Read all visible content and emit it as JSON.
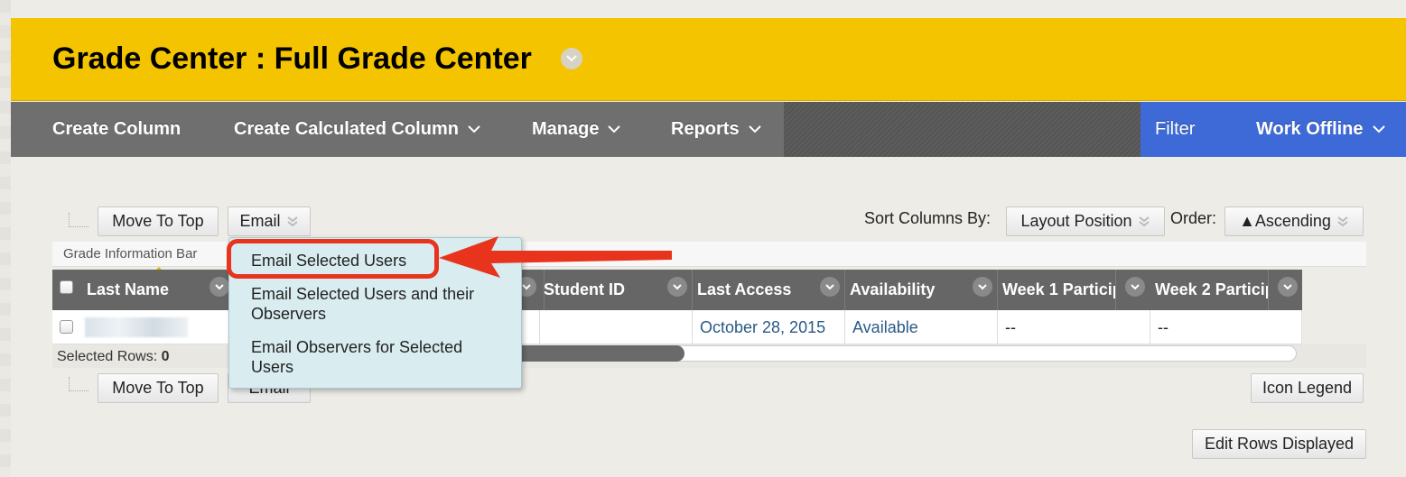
{
  "header": {
    "title": "Grade Center : Full Grade Center"
  },
  "nav": {
    "create_column": "Create Column",
    "create_calculated_column": "Create Calculated Column",
    "manage": "Manage",
    "reports": "Reports",
    "filter": "Filter",
    "work_offline": "Work Offline"
  },
  "toolbar": {
    "move_to_top": "Move To Top",
    "email": "Email",
    "sort_columns_by_label": "Sort Columns By:",
    "sort_columns_by_value": "Layout Position",
    "order_label": "Order:",
    "order_value": "▲Ascending"
  },
  "info_bar": {
    "label": "Grade Information Bar"
  },
  "grid": {
    "columns": [
      "Last Name",
      "Student ID",
      "Last Access",
      "Availability",
      "Week 1 Particip",
      "Week 2 Particip"
    ],
    "row": {
      "student_id": "",
      "last_access": "October 28, 2015",
      "availability": "Available",
      "week1": "--",
      "week2": "--"
    },
    "selected_rows_label": "Selected Rows:",
    "selected_rows_count": "0"
  },
  "email_menu": {
    "items": [
      "Email Selected Users",
      "Email Selected Users and their",
      "Observers",
      "Email Observers for Selected",
      "Users"
    ]
  },
  "bottom_toolbar": {
    "move_to_top": "Move To Top",
    "email": "Email",
    "icon_legend": "Icon Legend",
    "edit_rows_displayed": "Edit Rows Displayed"
  },
  "colors": {
    "header_bg": "#f5c400",
    "nav_bg": "#6f6f6f",
    "nav_accent": "#3d6ad6",
    "menu_bg": "#d9ecf0",
    "highlight": "#e8341c",
    "link": "#2a5a86"
  }
}
